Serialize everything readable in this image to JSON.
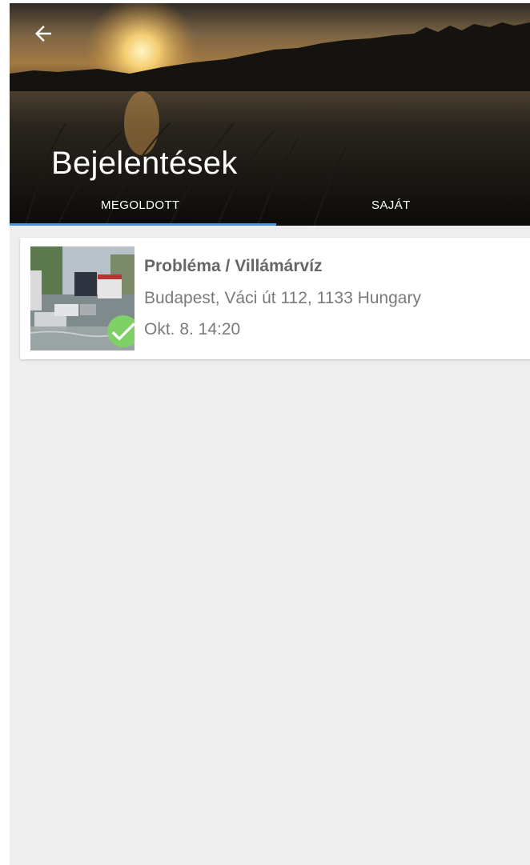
{
  "header": {
    "title": "Bejelentések",
    "back_icon": "arrow-left-icon"
  },
  "tabs": [
    {
      "label": "MEGOLDOTT",
      "active": true
    },
    {
      "label": "SAJÁT",
      "active": false
    }
  ],
  "colors": {
    "tab_indicator": "#4a90d9",
    "background": "#eeeeee",
    "status_resolved": "#7ed067"
  },
  "reports": [
    {
      "title": "Probléma / Villámárvíz",
      "address": "Budapest, Váci út 112, 1133 Hungary",
      "date": "Okt. 8. 14:20",
      "status_icon": "check-icon"
    }
  ]
}
